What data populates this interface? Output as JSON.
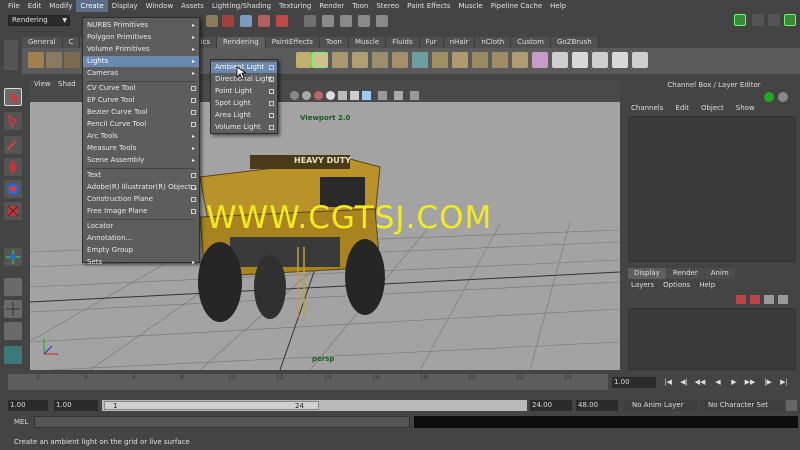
{
  "menubar": {
    "items": [
      "File",
      "Edit",
      "Modify",
      "Create",
      "Display",
      "Window",
      "Assets",
      "Lighting/Shading",
      "Texturing",
      "Render",
      "Toon",
      "Stereo",
      "Paint Effects",
      "Muscle",
      "Pipeline Cache",
      "Help"
    ],
    "active_index": 3
  },
  "status_line": {
    "mode": "Rendering"
  },
  "shelf": {
    "tabs": [
      "General",
      "C",
      "rmation",
      "Animation",
      "Dynamics",
      "Rendering",
      "PaintEffects",
      "Toon",
      "Muscle",
      "Fluids",
      "Fur",
      "nHair",
      "nCloth",
      "Custom",
      "GoZBrush"
    ]
  },
  "viewport": {
    "menu": [
      "View",
      "Shad"
    ],
    "title": "Viewport 2.0",
    "camera": "persp",
    "watermark": "WWW.CGTSJ.COM"
  },
  "channel_box": {
    "header": "Channel Box / Layer Editor",
    "menu": [
      "Channels",
      "Edit",
      "Object",
      "Show"
    ]
  },
  "layer_editor": {
    "tabs": [
      "Display",
      "Render",
      "Anim"
    ],
    "menu": [
      "Layers",
      "Options",
      "Help"
    ]
  },
  "create_menu": {
    "items": [
      {
        "label": "NURBS Primitives",
        "kind": "submenu"
      },
      {
        "label": "Polygon Primitives",
        "kind": "submenu"
      },
      {
        "label": "Volume Primitives",
        "kind": "submenu"
      },
      {
        "label": "Lights",
        "kind": "submenu",
        "highlighted": true
      },
      {
        "label": "Cameras",
        "kind": "submenu"
      },
      {
        "label": "CV Curve Tool",
        "kind": "option"
      },
      {
        "label": "EP Curve Tool",
        "kind": "option"
      },
      {
        "label": "Bezier Curve Tool",
        "kind": "option"
      },
      {
        "label": "Pencil Curve Tool",
        "kind": "option"
      },
      {
        "label": "Arc Tools",
        "kind": "submenu"
      },
      {
        "label": "Measure Tools",
        "kind": "submenu"
      },
      {
        "label": "Scene Assembly",
        "kind": "submenu"
      },
      {
        "label": "Text",
        "kind": "option"
      },
      {
        "label": "Adobe(R) Illustrator(R) Object...",
        "kind": "option"
      },
      {
        "label": "Construction Plane",
        "kind": "option"
      },
      {
        "label": "Free Image Plane",
        "kind": "option"
      },
      {
        "label": "Locator",
        "kind": "plain"
      },
      {
        "label": "Annotation...",
        "kind": "plain"
      },
      {
        "label": "Empty Group",
        "kind": "plain"
      },
      {
        "label": "Sets",
        "kind": "submenu"
      }
    ]
  },
  "lights_menu": {
    "items": [
      {
        "label": "Ambient Light",
        "highlighted": true
      },
      {
        "label": "Directional Light"
      },
      {
        "label": "Point Light"
      },
      {
        "label": "Spot Light"
      },
      {
        "label": "Area Light"
      },
      {
        "label": "Volume Light"
      }
    ]
  },
  "time_slider": {
    "ticks": [
      "2",
      "4",
      "6",
      "8",
      "10",
      "12",
      "14",
      "16",
      "18",
      "20",
      "22",
      "24"
    ],
    "current_frame": "1.00"
  },
  "range_slider": {
    "start_field": "1.00",
    "start_inner": "1.00",
    "range_start": "1",
    "range_end": "24",
    "end_field": "24.00",
    "end_total": "48.00",
    "anim_layer": "No Anim Layer",
    "character_set": "No Character Set"
  },
  "command_line": {
    "label": "MEL"
  },
  "help_line": {
    "text": "Create an ambient light on the grid or live surface"
  },
  "colors": {
    "menu_highlight": "#6b88b0",
    "viewport_bg": "#a3a3a3",
    "watermark": "#f3ec1c"
  }
}
